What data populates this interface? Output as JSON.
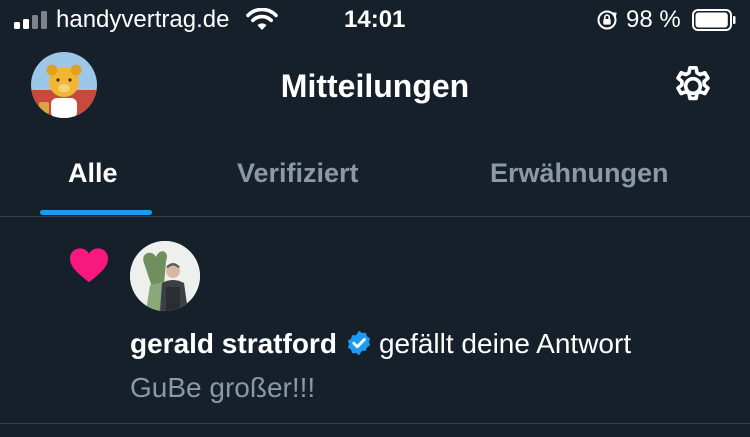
{
  "status_bar": {
    "carrier": "handyvertrag.de",
    "time": "14:01",
    "battery_percent": "98 %",
    "battery_level": 0.98,
    "icons": [
      "signal-icon",
      "wifi-icon",
      "rotation-lock-icon",
      "battery-icon"
    ]
  },
  "header": {
    "title": "Mitteilungen",
    "icons": [
      "profile-avatar",
      "gear-icon"
    ]
  },
  "tabs": [
    {
      "label": "Alle",
      "active": true
    },
    {
      "label": "Verifiziert",
      "active": false
    },
    {
      "label": "Erwähnungen",
      "active": false
    }
  ],
  "notifications": [
    {
      "type_icon": "heart-icon",
      "user": "gerald stratford",
      "verified": true,
      "action": "gefällt deine Antwort",
      "text": "GuBe großer!!!"
    }
  ],
  "colors": {
    "background": "#15202b",
    "accent": "#1d9bf0",
    "muted_text": "#8b98a5",
    "heart": "#f91880",
    "divider": "#38444d"
  }
}
